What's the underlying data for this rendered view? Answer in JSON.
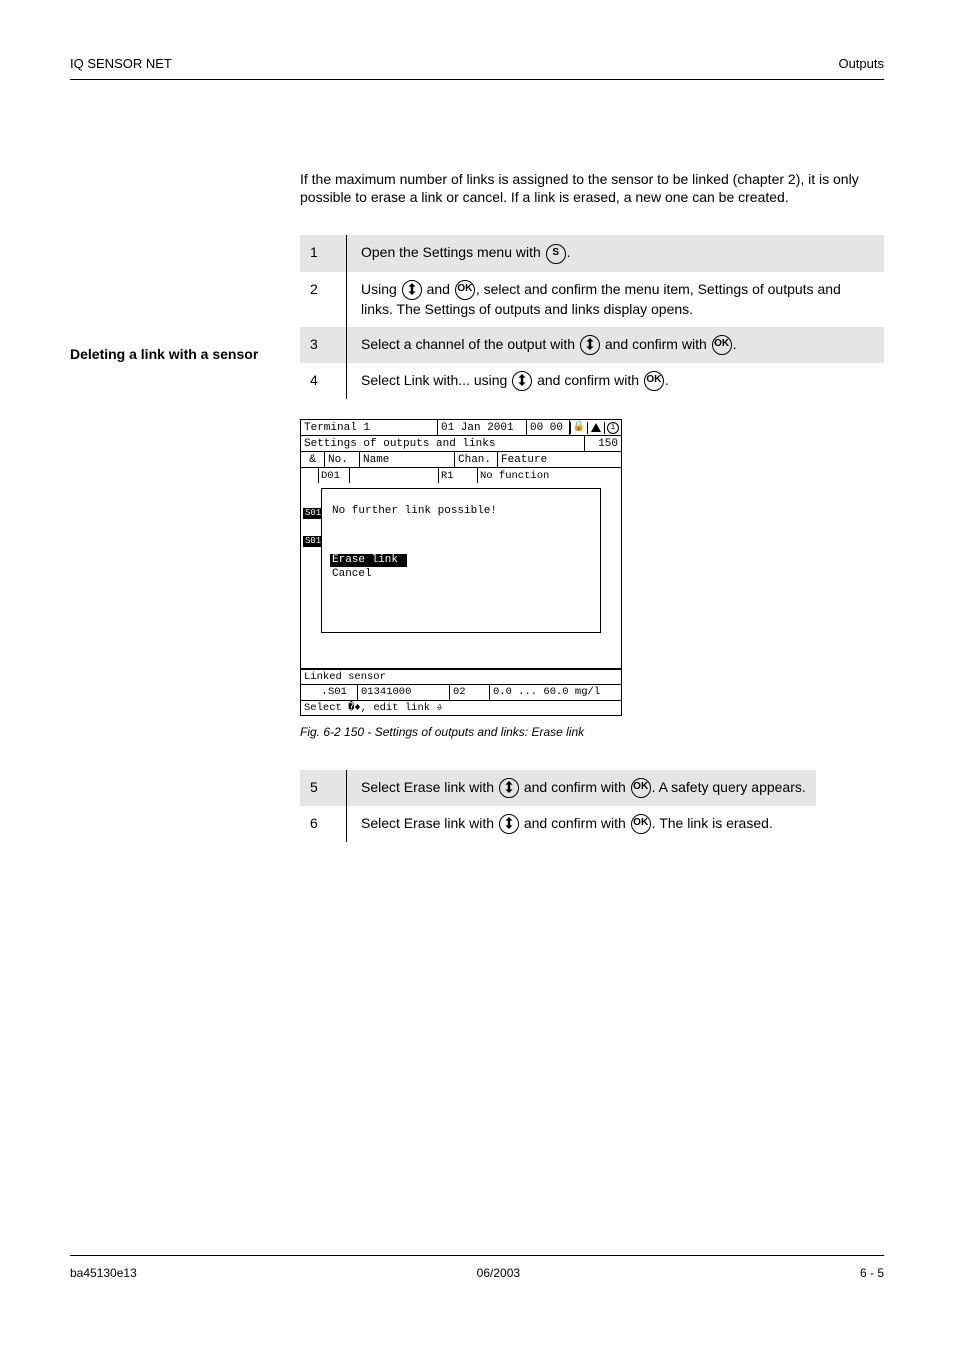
{
  "header": {
    "left": "IQ SENSOR NET",
    "right": "Outputs"
  },
  "footer": {
    "left": "ba45130e13",
    "center": "06/2003",
    "right": "6 - 5"
  },
  "intro": "If the maximum number of links is assigned to the sensor to be linked (chapter 2), it is only possible to erase a link or cancel. If a link is erased, a new one can be created.",
  "side_heading": "Deleting a link with a sensor",
  "steps1": [
    {
      "n": "1",
      "text_before": "Open the Settings menu with ",
      "icon": "S",
      "text_after": ".",
      "shaded": true
    },
    {
      "n": "2",
      "text_before": "Using ",
      "icon": "updown",
      "text_mid": " and ",
      "icon2": "OK",
      "text_after": ", select and confirm the menu item, Settings of outputs and links. The Settings of outputs and links display opens.",
      "shaded": false
    },
    {
      "n": "3",
      "text_before": "Select a channel of the output with ",
      "icon": "updown",
      "text_mid": " and confirm with ",
      "icon2": "OK",
      "text_after": ".",
      "shaded": true
    },
    {
      "n": "4",
      "text_before": "Select Link with... using ",
      "icon": "updown",
      "text_mid": " and confirm with ",
      "icon2": "OK",
      "text_after": ".",
      "shaded": false
    }
  ],
  "terminal": {
    "title_left": "Terminal 1",
    "date": "01 Jan 2001",
    "time": "00 00",
    "subtitle": "Settings of outputs and links",
    "sub_right": "150",
    "head": {
      "c0": "&",
      "c1": "No.",
      "c2": "Name",
      "c3": "Chan.",
      "c4": "Feature"
    },
    "partial": {
      "c1": "D01",
      "c3": "R1",
      "c4": "No function"
    },
    "s_labels": [
      "S01",
      "S01"
    ],
    "dialog_msg": "No further link possible!",
    "opt_sel": "Erase link",
    "opt_other": "Cancel",
    "linked_label": "Linked sensor",
    "sensor": {
      "c0": "",
      "c1": "S01",
      "c2": "01341000",
      "c3": "02",
      "c4": "0.0 ... 60.0 mg/l"
    },
    "hint": "Select �♦, edit link ⎀"
  },
  "fig_caption": "Fig. 6-2   150 - Settings of outputs and links: Erase link",
  "steps2": [
    {
      "n": "5",
      "text_before": "Select Erase link with ",
      "icon": "updown",
      "text_mid": " and confirm with ",
      "icon2": "OK",
      "text_after": ". A safety query appears.",
      "shaded": true
    },
    {
      "n": "6",
      "text_before": "Select Erase link with ",
      "icon": "updown",
      "text_mid": " and confirm with ",
      "icon2": "OK",
      "text_after": ". The link is erased.",
      "shaded": false
    }
  ]
}
